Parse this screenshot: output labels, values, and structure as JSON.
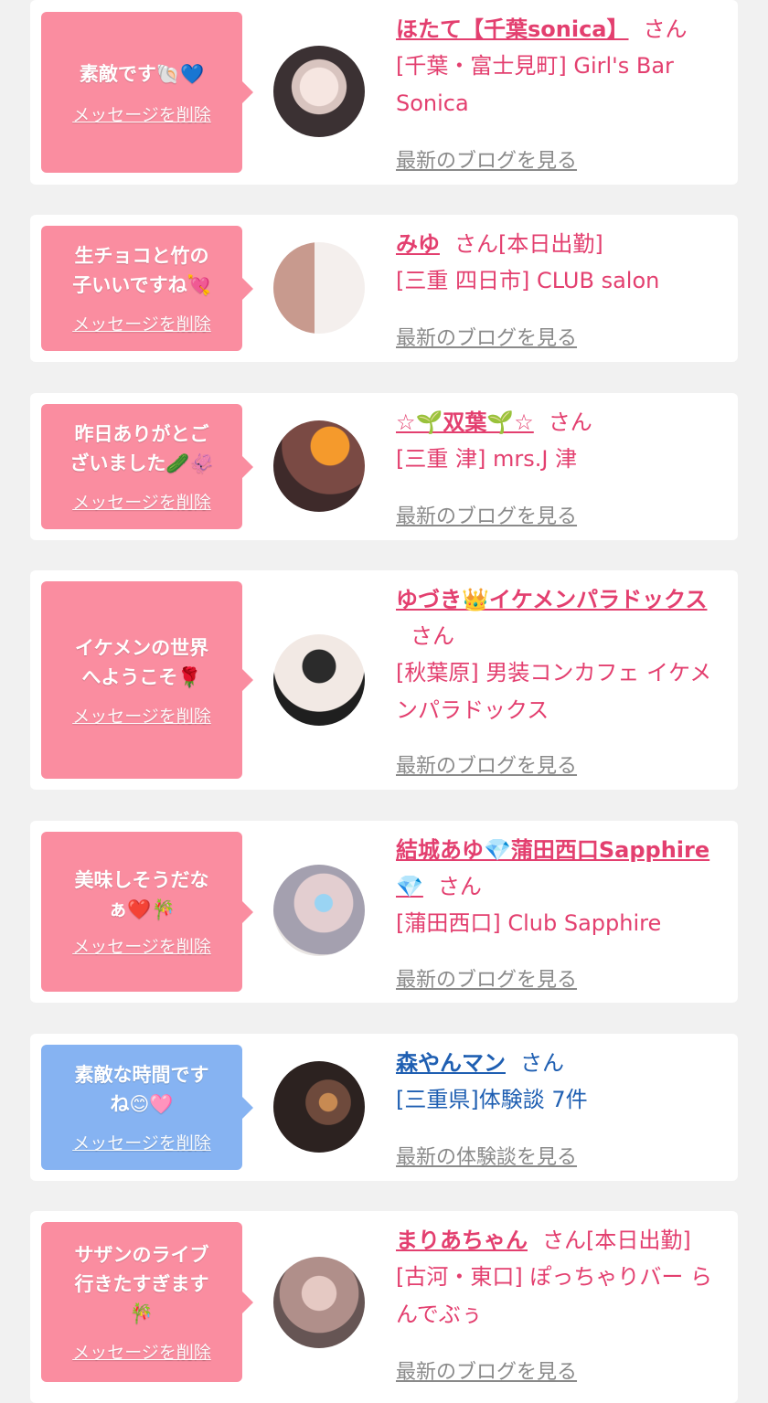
{
  "delete_label": "メッセージを削除",
  "items": [
    {
      "message": "素敵です🐚💙",
      "name": "ほたて【千葉sonica】",
      "suffix": "さん",
      "shop": "[千葉・富士見町] Girl's Bar Sonica",
      "link": "最新のブログを見る",
      "theme": "pink",
      "avatar_colors": [
        "#e9dcd8",
        "#3b3133"
      ]
    },
    {
      "message": "生チョコと竹の子いいですね💘",
      "name": "みゆ",
      "suffix": "さん[本日出勤]",
      "shop": "[三重 四日市] CLUB salon",
      "link": "最新のブログを見る",
      "theme": "pink",
      "avatar_colors": [
        "#f2e6df",
        "#c9a89c"
      ]
    },
    {
      "message": "昨日ありがとございました🥒🦑",
      "name": "☆🌱双葉🌱☆",
      "suffix": "さん",
      "shop": "[三重 津] mrs.J 津",
      "link": "最新のブログを見る",
      "theme": "pink",
      "avatar_colors": [
        "#5e3a3a",
        "#f59a2c"
      ]
    },
    {
      "message": "イケメンの世界へようこそ🌹",
      "name": "ゆづき👑イケメンパラドックス",
      "suffix": "さん",
      "shop": "[秋葉原] 男装コンカフェ イケメンパラドックス",
      "link": "最新のブログを見る",
      "theme": "pink",
      "avatar_colors": [
        "#efe7e2",
        "#242424"
      ]
    },
    {
      "message": "美味しそうだなぁ❤️🎋",
      "name": "結城あゆ💎蒲田西口Sapphire💎",
      "suffix": "さん",
      "shop": "[蒲田西口] Club Sapphire",
      "link": "最新のブログを見る",
      "theme": "pink",
      "avatar_colors": [
        "#ebe6e4",
        "#a9a4b3"
      ]
    },
    {
      "message": "素敵な時間ですね😊🩷",
      "name": "森やんマン",
      "suffix": "さん",
      "shop": "[三重県]体験談 7件",
      "link": "最新の体験談を見る",
      "theme": "blue",
      "avatar_colors": [
        "#2d2220",
        "#a86e43"
      ]
    },
    {
      "message": "サザンのライブ行きたすぎます🎋",
      "name": "まりあちゃん",
      "suffix": "さん[本日出勤]",
      "shop": "[古河・東口] ぽっちゃりバー らんでぶぅ",
      "link": "最新のブログを見る",
      "theme": "pink",
      "avatar_colors": [
        "#b79a94",
        "#6c5a58"
      ]
    }
  ]
}
